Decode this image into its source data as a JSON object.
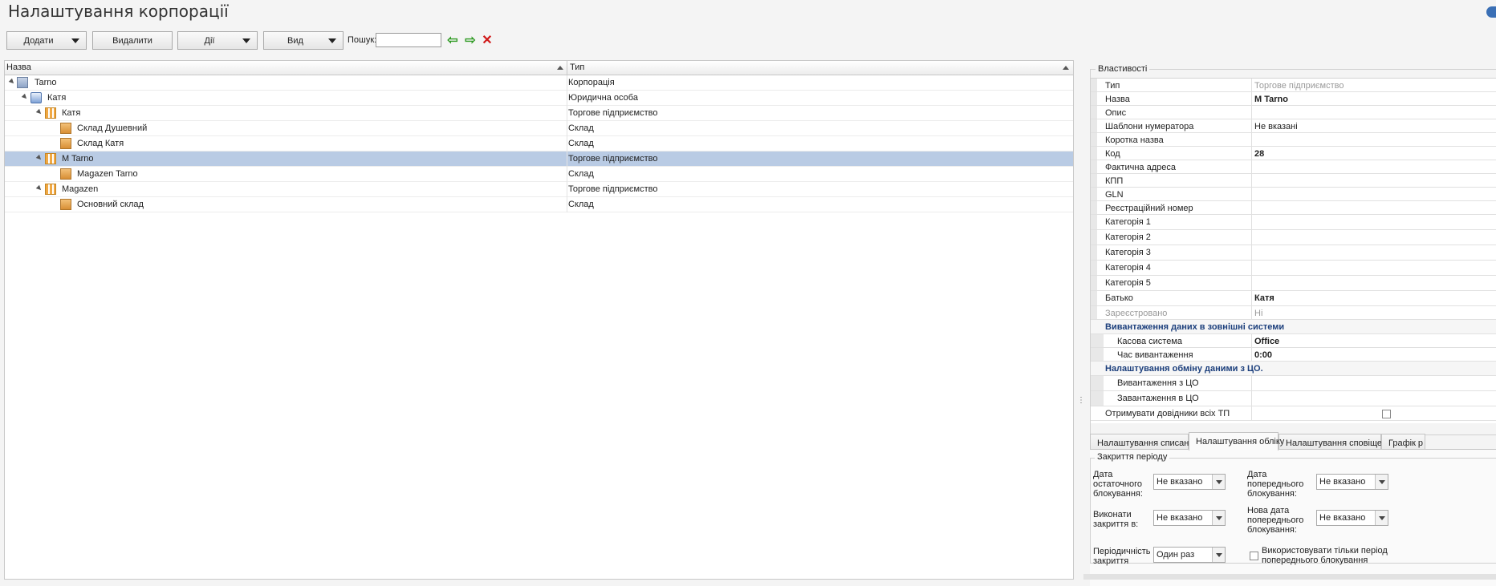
{
  "title": "Налаштування корпорації",
  "toolbar": {
    "add": "Додати",
    "delete": "Видалити",
    "actions": "Дії",
    "view": "Вид",
    "search_label": "Пошук:",
    "search_value": ""
  },
  "tree": {
    "columns": [
      "Назва",
      "Тип"
    ],
    "rows": [
      {
        "name": "Tarno",
        "type": "Корпорація"
      },
      {
        "name": "Катя",
        "type": "Юридична особа"
      },
      {
        "name": "Катя",
        "type": "Торгове підприємство"
      },
      {
        "name": "Склад Душевний",
        "type": "Склад"
      },
      {
        "name": "Склад Катя",
        "type": "Склад"
      },
      {
        "name": "M Tarno",
        "type": "Торгове підприємство"
      },
      {
        "name": "Magazen Tarno",
        "type": "Склад"
      },
      {
        "name": "Magazen",
        "type": "Торгове підприємство"
      },
      {
        "name": "Основний склад",
        "type": "Склад"
      }
    ]
  },
  "props": {
    "group_title": "Властивості",
    "rows": [
      {
        "k": "Тип",
        "v": "Торгове підприємство"
      },
      {
        "k": "Назва",
        "v": "M Tarno"
      },
      {
        "k": "Опис",
        "v": ""
      },
      {
        "k": "Шаблони нумератора",
        "v": "Не вказані"
      },
      {
        "k": "Коротка назва",
        "v": ""
      },
      {
        "k": "Код",
        "v": "28"
      },
      {
        "k": "Фактична адреса",
        "v": ""
      },
      {
        "k": "КПП",
        "v": ""
      },
      {
        "k": "GLN",
        "v": ""
      },
      {
        "k": "Реєстраційний номер",
        "v": ""
      },
      {
        "k": "Категорія 1",
        "v": ""
      },
      {
        "k": "Категорія 2",
        "v": ""
      },
      {
        "k": "Категорія 3",
        "v": ""
      },
      {
        "k": "Категорія 4",
        "v": ""
      },
      {
        "k": "Категорія 5",
        "v": ""
      },
      {
        "k": "Батько",
        "v": "Катя"
      },
      {
        "k": "Зареєстровано",
        "v": "Ні"
      }
    ],
    "section1": {
      "title": "Вивантаження даних в зовнішні системи",
      "rows": [
        {
          "k": "Касова система",
          "v": "Office"
        },
        {
          "k": "Час вивантаження",
          "v": "0:00"
        }
      ]
    },
    "section2": {
      "title": "Налаштування обміну даними з ЦО.",
      "rows": [
        {
          "k": "Вивантаження з ЦО",
          "v": ""
        },
        {
          "k": "Завантаження в ЦО",
          "v": ""
        }
      ]
    },
    "last_row": {
      "k": "Отримувати довідники всіх ТП"
    }
  },
  "tabs": [
    "Налаштування списання",
    "Налаштування обліку",
    "Налаштування сповіщень",
    "Графік р"
  ],
  "period": {
    "title": "Закриття періоду",
    "final_block_label": "Дата остаточного блокування:",
    "final_block_value": "Не вказано",
    "prev_block_label": "Дата попереднього блокування:",
    "prev_block_value": "Не вказано",
    "close_in_label": "Виконати закриття в:",
    "close_in_value": "Не вказано",
    "new_prev_label": "Нова дата попереднього блокування:",
    "new_prev_value": "Не вказано",
    "periodicity_label": "Періодичність закриття",
    "periodicity_value": "Один раз",
    "use_prev_only_label": "Використовувати тільки період попереднього блокування"
  },
  "colors": {
    "selection": "#b9cbe4",
    "section_text": "#1c3f7c",
    "accept": "#2e9a22",
    "cancel": "#d01818"
  }
}
